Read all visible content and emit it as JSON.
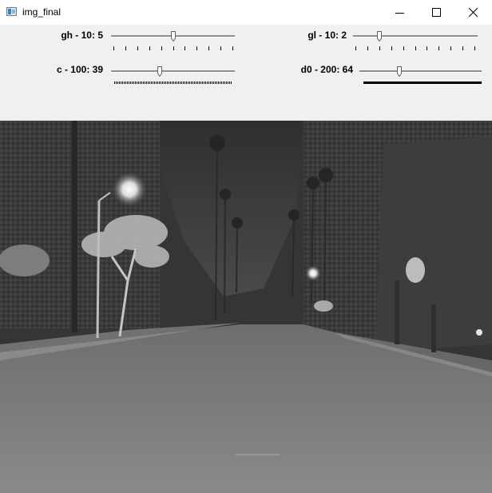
{
  "window": {
    "title": "img_final"
  },
  "sliders": [
    {
      "label": "gh - 10: 5",
      "value": 5,
      "max": 10
    },
    {
      "label": "gl - 10: 2",
      "value": 2,
      "max": 10
    },
    {
      "label": "c - 100: 39",
      "value": 39,
      "max": 100
    },
    {
      "label": "d0 - 200: 64",
      "value": 64,
      "max": 200
    }
  ]
}
